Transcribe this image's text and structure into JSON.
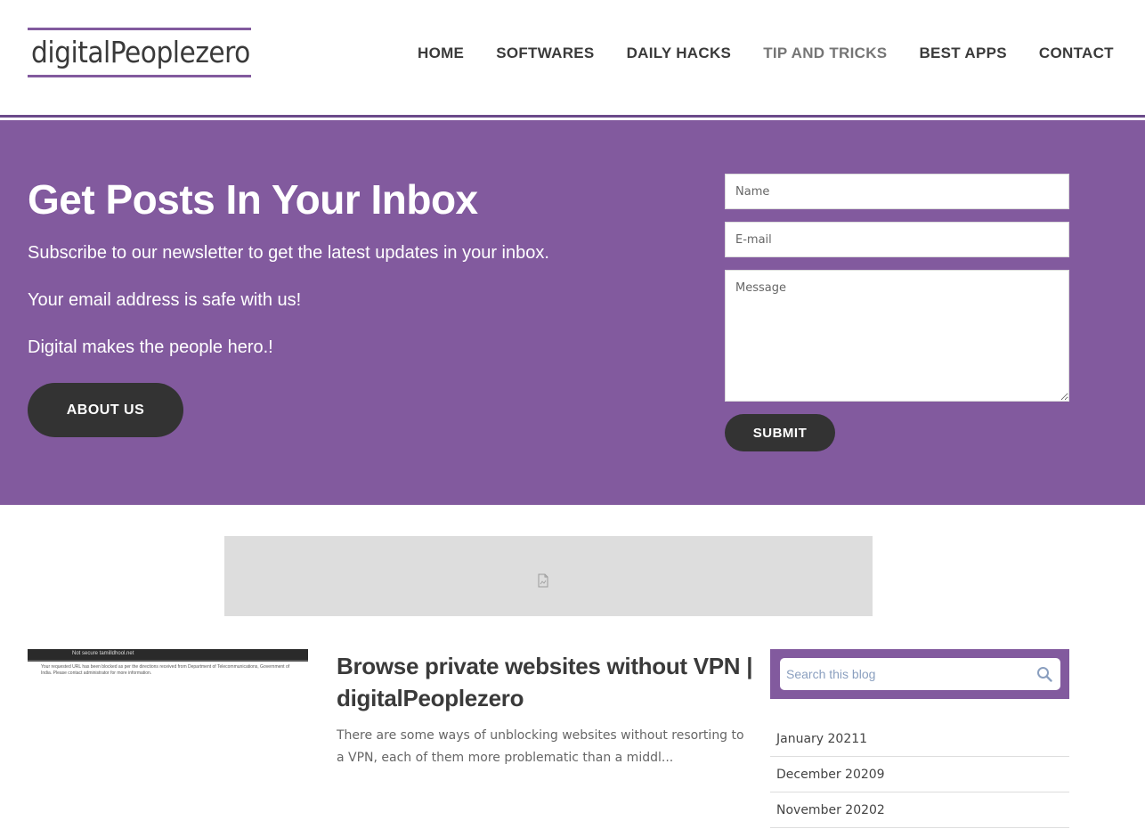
{
  "header": {
    "logo": "digitalPeoplezero",
    "nav": [
      {
        "label": "HOME"
      },
      {
        "label": "SOFTWARES"
      },
      {
        "label": "DAILY HACKS"
      },
      {
        "label": "TIP AND TRICKS",
        "active": true
      },
      {
        "label": "BEST APPS"
      },
      {
        "label": "CONTACT"
      }
    ]
  },
  "hero": {
    "title": "Get Posts In Your Inbox",
    "lines": [
      "Subscribe to our newsletter to get the latest updates in your inbox.",
      "Your email address is safe with us!",
      "Digital makes the people hero.!"
    ],
    "about_button": "ABOUT US",
    "form": {
      "name_placeholder": "Name",
      "email_placeholder": "E-mail",
      "message_placeholder": "Message",
      "submit_label": "SUBMIT"
    }
  },
  "post": {
    "thumbnail": {
      "url_text": "Not secure   tamilldhool.net",
      "body_text": "Your requested URL has been blocked as per the directions received from Department of Telecommunications, Government of India. Please contact administrator for more information."
    },
    "title": "Browse private websites without VPN | digitalPeoplezero",
    "excerpt": "There are some ways of unblocking websites without resorting to a VPN, each of them more problematic than a middl..."
  },
  "sidebar": {
    "search_placeholder": "Search this blog",
    "archive": [
      {
        "label": "January 20211"
      },
      {
        "label": "December 20209"
      },
      {
        "label": "November 20202"
      }
    ]
  },
  "colors": {
    "brand_purple": "#825a9e",
    "button_dark": "#333333",
    "ad_gray": "#dddddd"
  }
}
